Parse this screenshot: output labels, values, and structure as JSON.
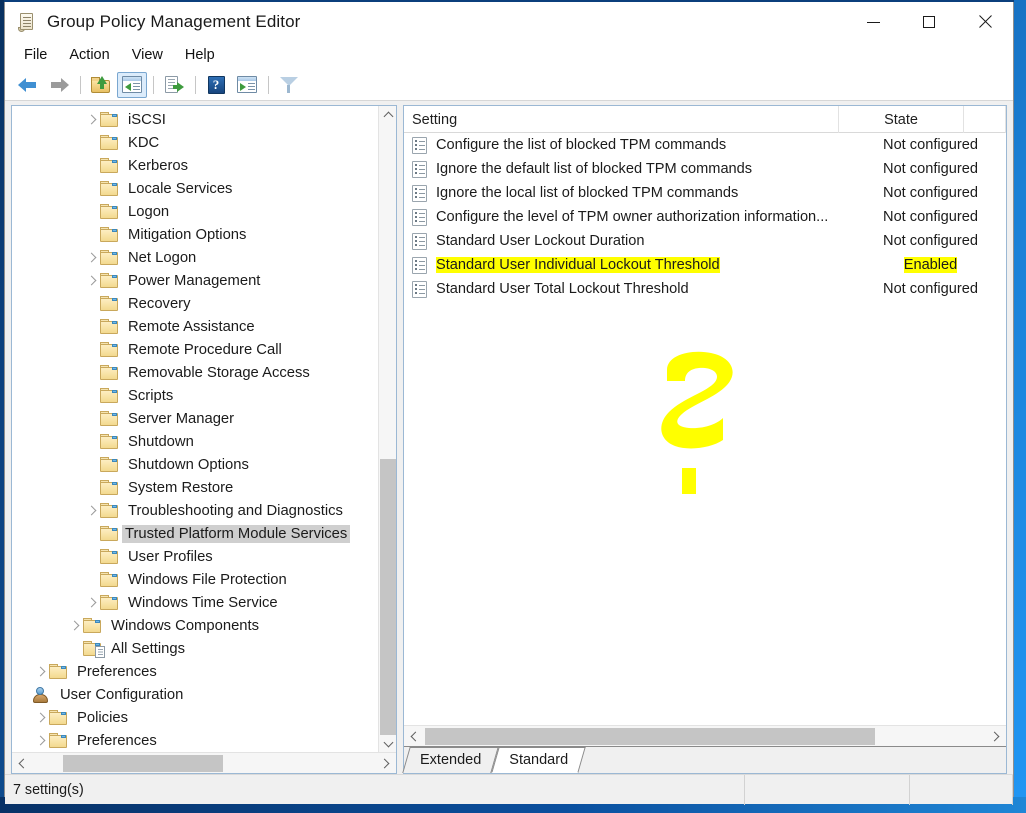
{
  "window": {
    "title": "Group Policy Management Editor",
    "app_icon": "document-scroll-icon",
    "controls": {
      "minimize": "minimize-icon",
      "maximize": "maximize-icon",
      "close": "close-icon"
    }
  },
  "menubar": {
    "items": [
      "File",
      "Action",
      "View",
      "Help"
    ]
  },
  "toolbar": {
    "buttons": [
      {
        "name": "back-arrow-icon",
        "kind": "arrow-left"
      },
      {
        "name": "forward-arrow-icon",
        "kind": "arrow-right"
      },
      {
        "name": "up-one-level-icon",
        "kind": "folder-up"
      },
      {
        "name": "show-hide-console-tree-icon",
        "kind": "console-tree",
        "pressed": true
      },
      {
        "name": "export-list-icon",
        "kind": "export"
      },
      {
        "name": "help-icon",
        "kind": "help",
        "glyph": "?"
      },
      {
        "name": "show-action-pane-icon",
        "kind": "action-pane"
      },
      {
        "name": "filter-icon",
        "kind": "filter"
      }
    ]
  },
  "tree": {
    "nodes": [
      {
        "label": "iSCSI",
        "indent": 4,
        "expander": true,
        "icon": "folder-icon"
      },
      {
        "label": "KDC",
        "indent": 4,
        "expander": false,
        "icon": "folder-icon"
      },
      {
        "label": "Kerberos",
        "indent": 4,
        "expander": false,
        "icon": "folder-icon"
      },
      {
        "label": "Locale Services",
        "indent": 4,
        "expander": false,
        "icon": "folder-icon"
      },
      {
        "label": "Logon",
        "indent": 4,
        "expander": false,
        "icon": "folder-icon"
      },
      {
        "label": "Mitigation Options",
        "indent": 4,
        "expander": false,
        "icon": "folder-icon"
      },
      {
        "label": "Net Logon",
        "indent": 4,
        "expander": true,
        "icon": "folder-icon"
      },
      {
        "label": "Power Management",
        "indent": 4,
        "expander": true,
        "icon": "folder-icon"
      },
      {
        "label": "Recovery",
        "indent": 4,
        "expander": false,
        "icon": "folder-icon"
      },
      {
        "label": "Remote Assistance",
        "indent": 4,
        "expander": false,
        "icon": "folder-icon"
      },
      {
        "label": "Remote Procedure Call",
        "indent": 4,
        "expander": false,
        "icon": "folder-icon"
      },
      {
        "label": "Removable Storage Access",
        "indent": 4,
        "expander": false,
        "icon": "folder-icon"
      },
      {
        "label": "Scripts",
        "indent": 4,
        "expander": false,
        "icon": "folder-icon"
      },
      {
        "label": "Server Manager",
        "indent": 4,
        "expander": false,
        "icon": "folder-icon"
      },
      {
        "label": "Shutdown",
        "indent": 4,
        "expander": false,
        "icon": "folder-icon"
      },
      {
        "label": "Shutdown Options",
        "indent": 4,
        "expander": false,
        "icon": "folder-icon"
      },
      {
        "label": "System Restore",
        "indent": 4,
        "expander": false,
        "icon": "folder-icon"
      },
      {
        "label": "Troubleshooting and Diagnostics",
        "indent": 4,
        "expander": true,
        "icon": "folder-icon"
      },
      {
        "label": "Trusted Platform Module Services",
        "indent": 4,
        "expander": false,
        "icon": "folder-icon",
        "selected": true
      },
      {
        "label": "User Profiles",
        "indent": 4,
        "expander": false,
        "icon": "folder-icon"
      },
      {
        "label": "Windows File Protection",
        "indent": 4,
        "expander": false,
        "icon": "folder-icon"
      },
      {
        "label": "Windows Time Service",
        "indent": 4,
        "expander": true,
        "icon": "folder-icon"
      },
      {
        "label": "Windows Components",
        "indent": 3,
        "expander": true,
        "icon": "folder-icon"
      },
      {
        "label": "All Settings",
        "indent": 3,
        "expander": false,
        "icon": "all-settings-icon"
      },
      {
        "label": "Preferences",
        "indent": 1,
        "expander": true,
        "icon": "folder-icon"
      },
      {
        "label": "User Configuration",
        "indent": 0,
        "expander": false,
        "icon": "user-configuration-icon"
      },
      {
        "label": "Policies",
        "indent": 1,
        "expander": true,
        "icon": "folder-icon"
      },
      {
        "label": "Preferences",
        "indent": 1,
        "expander": true,
        "icon": "folder-icon"
      }
    ]
  },
  "list": {
    "columns": [
      "Setting",
      "State"
    ],
    "rows": [
      {
        "setting": "Configure the list of blocked TPM commands",
        "state": "Not configured",
        "highlighted": false
      },
      {
        "setting": "Ignore the default list of blocked TPM commands",
        "state": "Not configured",
        "highlighted": false
      },
      {
        "setting": "Ignore the local list of blocked TPM commands",
        "state": "Not configured",
        "highlighted": false
      },
      {
        "setting": "Configure the level of TPM owner authorization information...",
        "state": "Not configured",
        "highlighted": false
      },
      {
        "setting": "Standard User Lockout Duration",
        "state": "Not configured",
        "highlighted": false
      },
      {
        "setting": "Standard User Individual Lockout Threshold",
        "state": "Enabled",
        "highlighted": true
      },
      {
        "setting": "Standard User Total Lockout Threshold",
        "state": "Not configured",
        "highlighted": false
      }
    ]
  },
  "annotation": {
    "mark": "question-mark",
    "color": "#ffff00"
  },
  "tabs": [
    {
      "label": "Extended",
      "active": false
    },
    {
      "label": "Standard",
      "active": true
    }
  ],
  "statusbar": {
    "text": "7 setting(s)",
    "cell2": "",
    "cell3": ""
  },
  "colors": {
    "highlight": "#ffff00",
    "selection": "#cfcfcf",
    "pane_border": "#9bb8d4",
    "desktop": "#0d4a8d"
  }
}
